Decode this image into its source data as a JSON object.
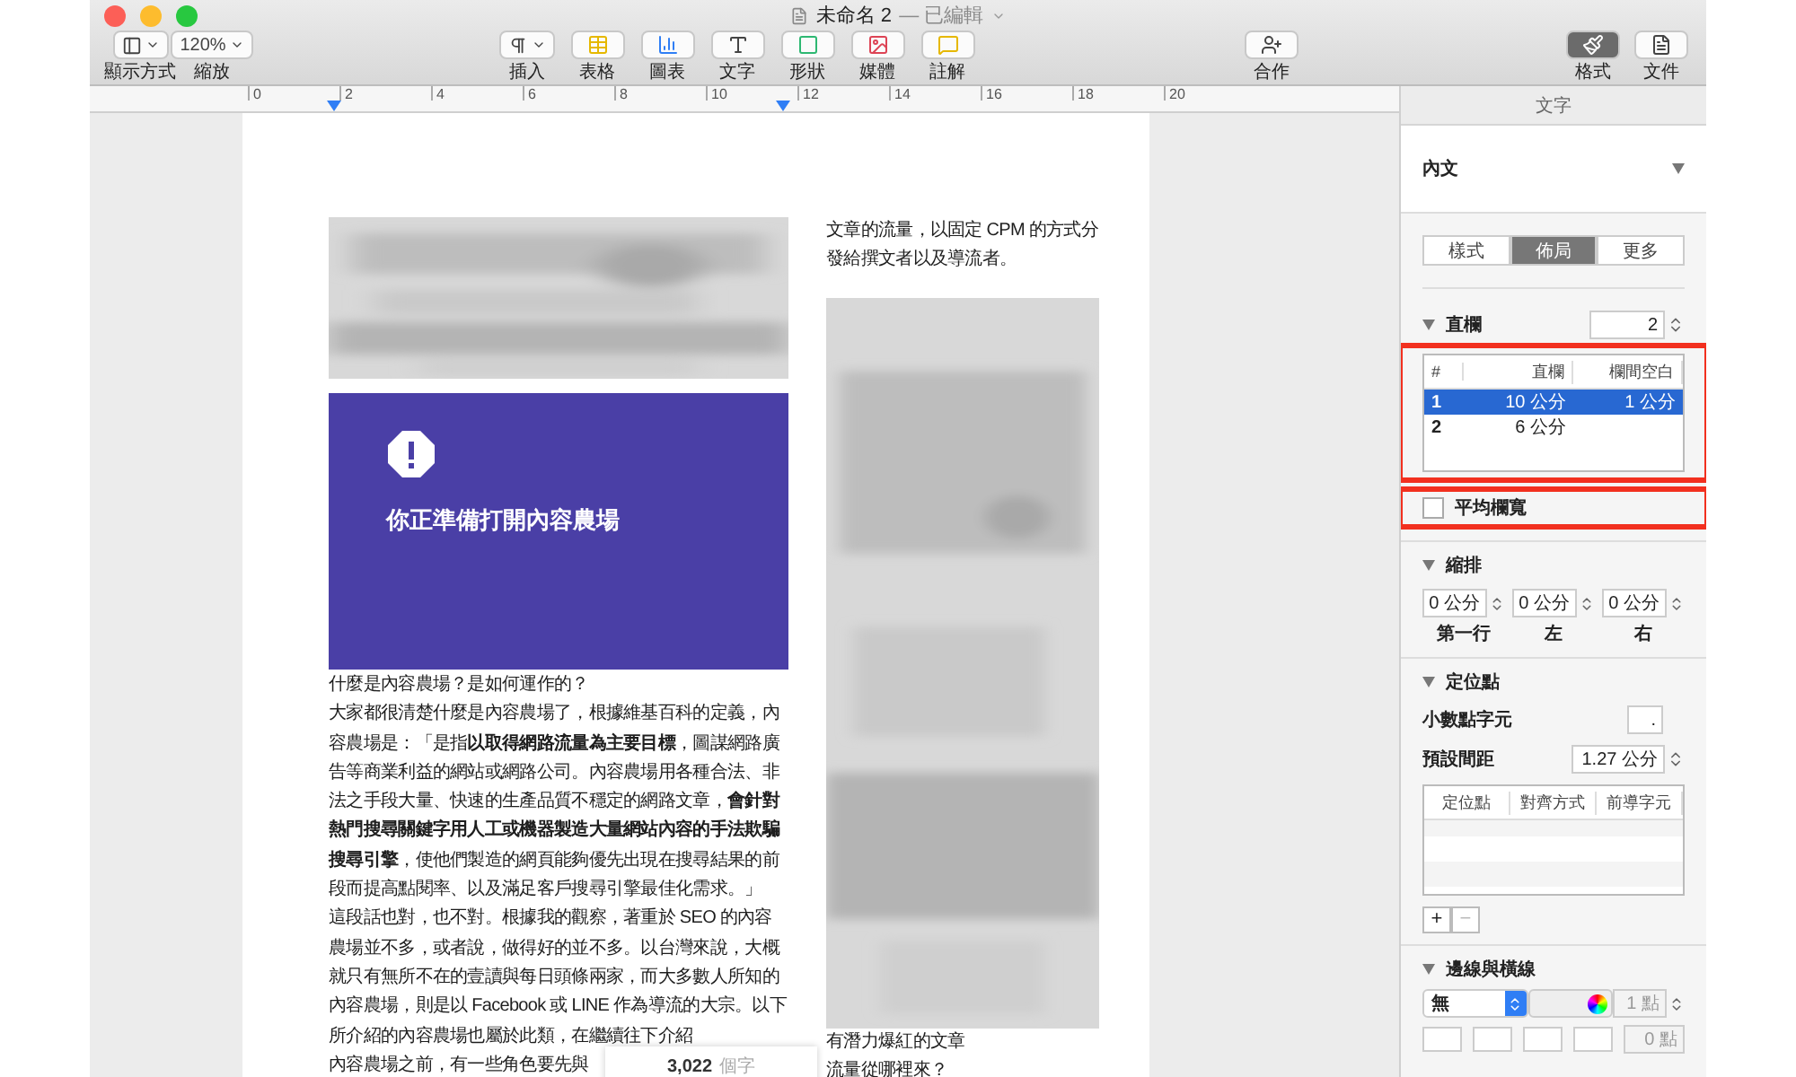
{
  "window": {
    "title": "未命名 2",
    "status": "— 已編輯"
  },
  "toolbar": {
    "left": [
      {
        "kind": "view",
        "label": "顯示方式"
      },
      {
        "kind": "zoom",
        "label": "縮放",
        "value": "120%"
      }
    ],
    "middle": [
      {
        "kind": "insert",
        "label": "插入"
      },
      {
        "kind": "table",
        "label": "表格"
      },
      {
        "kind": "chart",
        "label": "圖表"
      },
      {
        "kind": "text",
        "label": "文字"
      },
      {
        "kind": "shape",
        "label": "形狀"
      },
      {
        "kind": "media",
        "label": "媒體"
      },
      {
        "kind": "comment",
        "label": "註解"
      }
    ],
    "right": [
      {
        "kind": "collaborate",
        "label": "合作"
      }
    ],
    "inspector_tabs": [
      {
        "kind": "format",
        "label": "格式",
        "selected": true
      },
      {
        "kind": "document",
        "label": "文件",
        "selected": false
      }
    ]
  },
  "ruler": {
    "labels": [
      "0",
      "2",
      "4",
      "6",
      "8",
      "10",
      "12",
      "14",
      "16",
      "18",
      "20"
    ]
  },
  "document": {
    "column_1": {
      "image": {
        "kind": "picture"
      },
      "alert_card": {
        "message": "你正準備打開內容農場"
      },
      "paragraphs": [
        "什麼是內容農場？是如何運作的？",
        "大家都很清楚什麼是內容農場了，根據維基百科的定義，內容農場是：「是指**以取得網路流量為主要目標**，圖謀網路廣告等商業利益的網站或網路公司。內容農場用各種合法、非法之手段大量、快速的生產品質不穩定的網路文章，**會針對熱門搜尋關鍵字用人工或機器製造大量網站內容的手法欺騙搜尋引擎**，使他們製造的網頁能夠優先出現在搜尋結果的前段而提高點閱率、以及滿足客戶搜尋引擎最佳化需求。」",
        "這段話也對，也不對。根據我的觀察，著重於 SEO 的內容農場並不多，或者說，做得好的並不多。以台灣來說，大概就只有無所不在的壹讀與每日頭條兩家，而大多數人所知的內容農場，則是以 Facebook 或 LINE 作為導流的大宗。以下所介紹的內容農場也屬於此類，在繼續往下介紹"
      ],
      "covered_line": "內容農場之前，有一些角色要先與"
    },
    "column_2": {
      "paragraphs_top": [
        "文章的流量，以固定 CPM 的方式分發給撰文者以及導流者。"
      ],
      "image": {
        "kind": "picture"
      },
      "paragraphs_bottom": [
        "有潛力爆紅的文章",
        "流量從哪裡來？"
      ]
    },
    "word_count": {
      "value": "3,022",
      "unit": "個字"
    }
  },
  "sidebar": {
    "header": "文字",
    "paragraph_style": "內文",
    "segments": [
      {
        "label": "樣式",
        "selected": false
      },
      {
        "label": "佈局",
        "selected": true
      },
      {
        "label": "更多",
        "selected": false
      }
    ],
    "columns": {
      "title": "直欄",
      "expanded": true,
      "count": "2",
      "table": {
        "highlighted": true,
        "columns": [
          "#",
          "直欄",
          "欄間空白"
        ],
        "rows": [
          {
            "cells": [
              "1",
              "10 公分",
              "1 公分"
            ],
            "selected": true
          },
          {
            "cells": [
              "2",
              "6 公分"
            ],
            "selected": false
          }
        ]
      },
      "equal_width": {
        "label": "平均欄寬",
        "checked": false,
        "highlighted": true
      }
    },
    "indents": {
      "title": "縮排",
      "expanded": true,
      "fields": [
        {
          "value": "0 公分",
          "label": "第一行"
        },
        {
          "value": "0 公分",
          "label": "左"
        },
        {
          "value": "0 公分",
          "label": "右"
        }
      ]
    },
    "tabs": {
      "title": "定位點",
      "expanded": true,
      "decimal_label": "小數點字元",
      "decimal_value": ".",
      "spacing_label": "預設間距",
      "spacing_value": "1.27 公分",
      "table_columns": [
        "定位點",
        "對齊方式",
        "前導字元"
      ],
      "buttons": [
        {
          "label": "+",
          "disabled": false
        },
        {
          "label": "−",
          "disabled": true
        }
      ]
    },
    "borders": {
      "title": "邊線與橫線",
      "expanded": true,
      "style": "無",
      "width": "1 點",
      "offset": "0 點"
    }
  }
}
